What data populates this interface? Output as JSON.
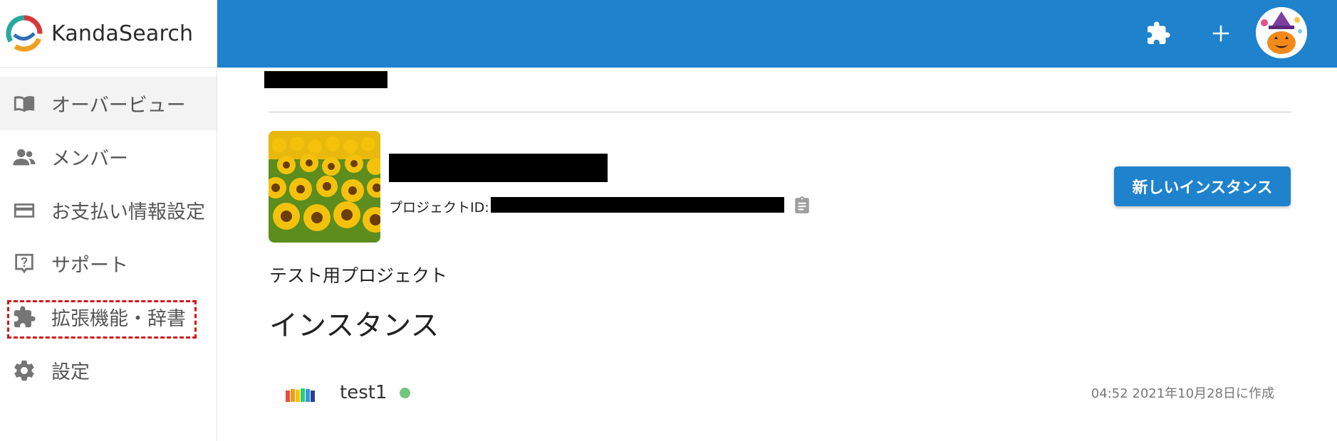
{
  "brand": {
    "name": "KandaSearch"
  },
  "sidebar": {
    "items": [
      {
        "label": "オーバービュー",
        "icon": "book-icon",
        "active": true
      },
      {
        "label": "メンバー",
        "icon": "people-icon"
      },
      {
        "label": "お支払い情報設定",
        "icon": "credit-card-icon"
      },
      {
        "label": "サポート",
        "icon": "help-icon"
      },
      {
        "label": "拡張機能・辞書",
        "icon": "puzzle-icon",
        "highlighted": true
      },
      {
        "label": "設定",
        "icon": "gear-icon"
      }
    ]
  },
  "header": {
    "color": "#1f82cc",
    "buttons": [
      "puzzle-icon",
      "plus-icon",
      "avatar"
    ]
  },
  "project": {
    "id_label": "プロジェクトID:",
    "description": "テスト用プロジェクト",
    "new_instance_button": "新しいインスタンス"
  },
  "instances": {
    "title": "インスタンス",
    "items": [
      {
        "name": "test1",
        "status": "running",
        "status_color": "#72c57a",
        "created": "04:52 2021年10月28日に作成"
      }
    ]
  },
  "colors": {
    "accent": "#1f82cc",
    "highlight_border": "#d0191b"
  }
}
